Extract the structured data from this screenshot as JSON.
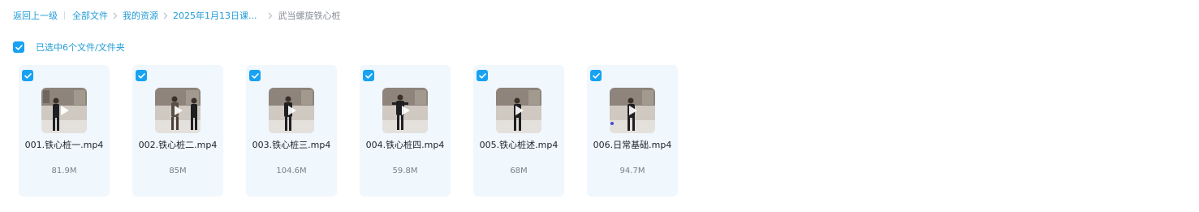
{
  "breadcrumb": {
    "back_label": "返回上一级",
    "items": [
      {
        "label": "全部文件"
      },
      {
        "label": "我的资源"
      },
      {
        "label": "2025年1月13日课..."
      }
    ],
    "current": "武当螺旋铁心桩"
  },
  "selection": {
    "label": "已选中6个文件/文件夹",
    "checked": true
  },
  "colors": {
    "accent": "#17a2f2",
    "link": "#1f9bd6",
    "card_bg": "#f0f7fd"
  },
  "files": [
    {
      "name": "001.铁心桩一.mp4",
      "size": "81.9M",
      "checked": true
    },
    {
      "name": "002.铁心桩二.mp4",
      "size": "85M",
      "checked": true
    },
    {
      "name": "003.铁心桩三.mp4",
      "size": "104.6M",
      "checked": true
    },
    {
      "name": "004.铁心桩四.mp4",
      "size": "59.8M",
      "checked": true
    },
    {
      "name": "005.铁心桩述.mp4",
      "size": "68M",
      "checked": true
    },
    {
      "name": "006.日常基础.mp4",
      "size": "94.7M",
      "checked": true
    }
  ]
}
